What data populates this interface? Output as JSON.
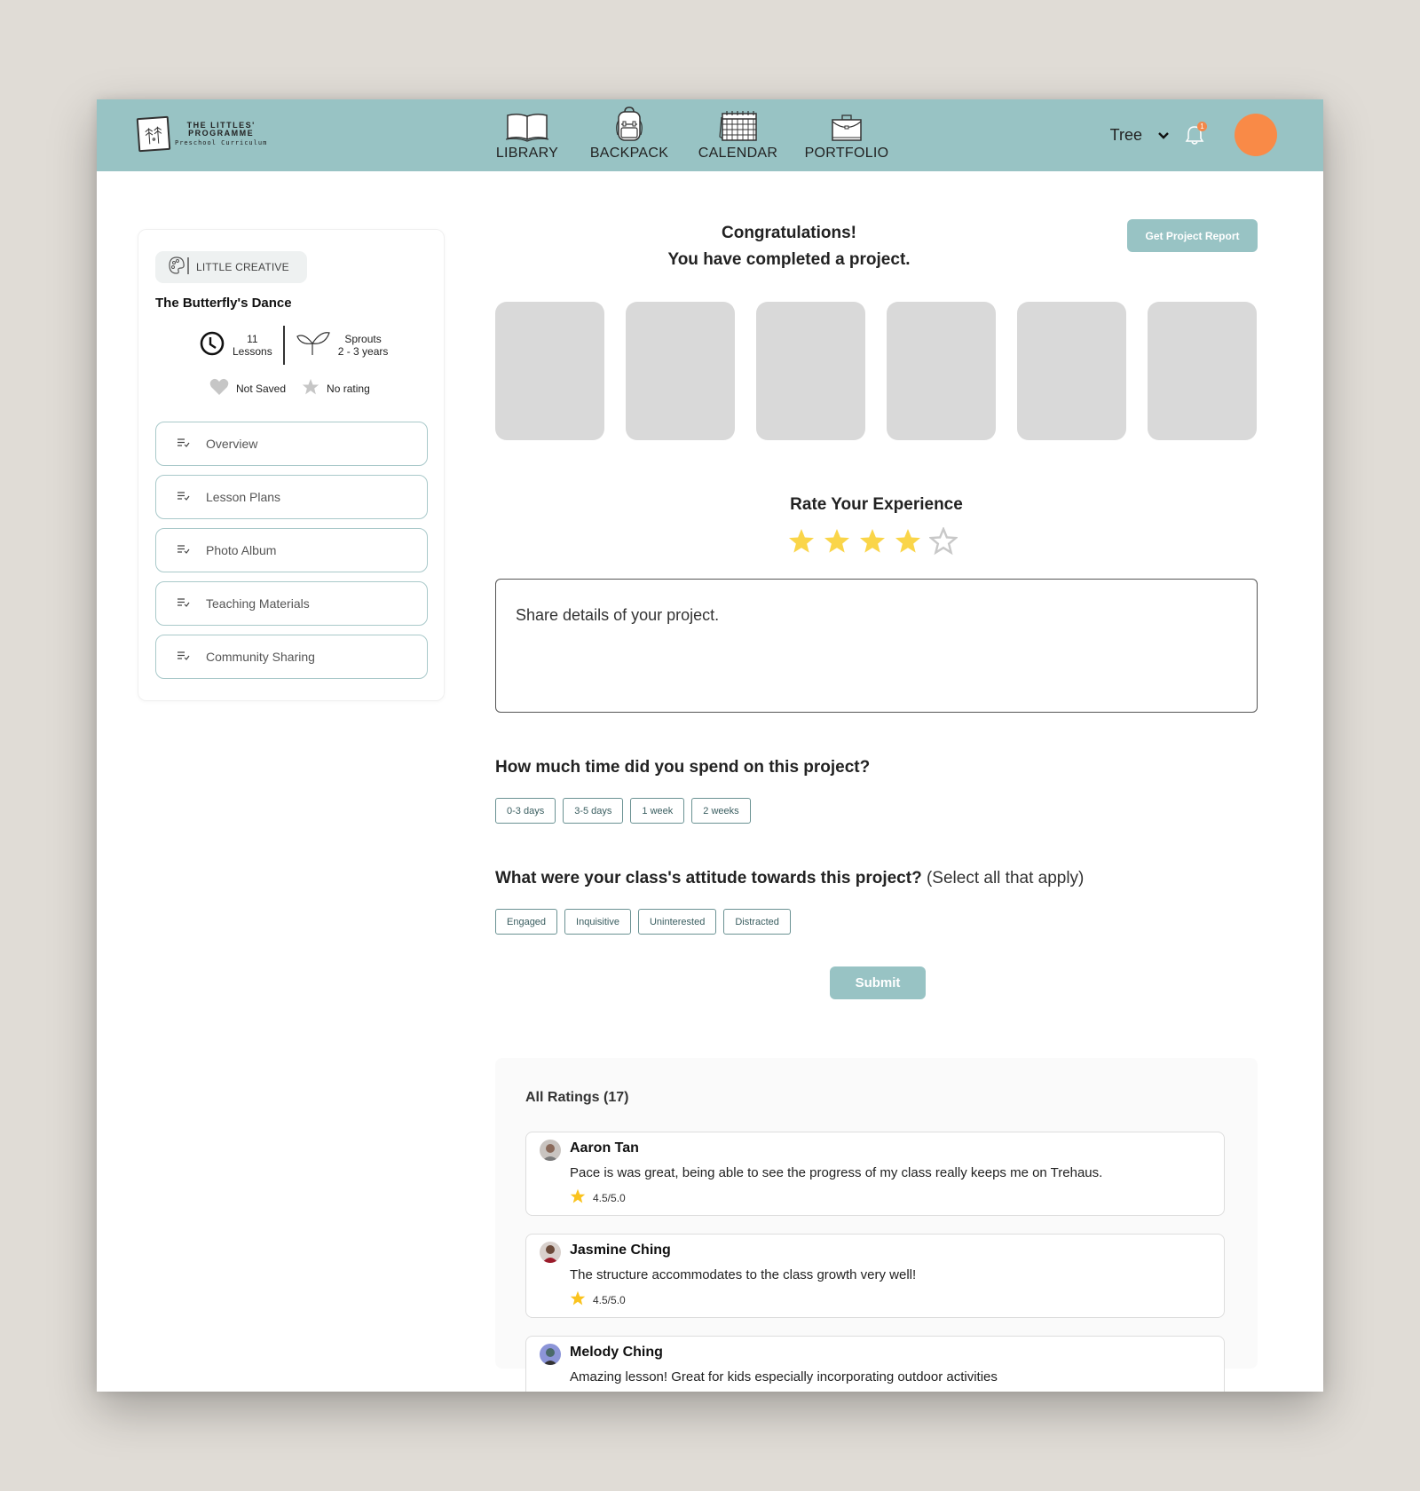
{
  "header": {
    "logo": {
      "line1": "THE LITTLES'",
      "line2": "PROGRAMME",
      "line3": "Preschool Curriculum"
    },
    "nav": [
      {
        "label": "LIBRARY",
        "icon": "book-icon"
      },
      {
        "label": "BACKPACK",
        "icon": "backpack-icon"
      },
      {
        "label": "CALENDAR",
        "icon": "calendar-icon"
      },
      {
        "label": "PORTFOLIO",
        "icon": "briefcase-icon"
      }
    ],
    "user": {
      "name": "Tree",
      "notification_count": "1",
      "avatar_color": "#f98a47"
    }
  },
  "sidebar": {
    "category": "LITTLE CREATIVE",
    "project_title": "The Butterfly's Dance",
    "lessons_count": "11",
    "lessons_label": "Lessons",
    "age_group": "Sprouts",
    "age_range": "2 - 3 years",
    "saved_status": "Not Saved",
    "rating_status": "No rating",
    "menu": [
      {
        "label": "Overview"
      },
      {
        "label": "Lesson Plans"
      },
      {
        "label": "Photo Album"
      },
      {
        "label": "Teaching Materials"
      },
      {
        "label": "Community Sharing"
      }
    ]
  },
  "main": {
    "congrats_line1": "Congratulations!",
    "congrats_line2": "You have completed a project.",
    "report_button": "Get Project Report",
    "photo_count": 6,
    "rate_title": "Rate Your Experience",
    "rating": {
      "value": 4,
      "max": 5,
      "filled_color": "#fad549",
      "empty_color": "#c8c8c8"
    },
    "details_placeholder": "Share details of your project.",
    "time_question": "How much time did you spend on this project?",
    "time_options": [
      "0-3 days",
      "3-5 days",
      "1 week",
      "2 weeks"
    ],
    "attitude_question": "What were your class's attitude towards this project?",
    "attitude_hint": "(Select all that apply)",
    "attitude_options": [
      "Engaged",
      "Inquisitive",
      "Uninterested",
      "Distracted"
    ],
    "submit_button": "Submit"
  },
  "ratings": {
    "title": "All Ratings (17)",
    "reviews": [
      {
        "name": "Aaron Tan",
        "text": "Pace is was great, being able to see the progress of my class really keeps me on Trehaus.",
        "score": "4.5/5.0"
      },
      {
        "name": "Jasmine Ching",
        "text": "The structure accommodates to the class growth very well!",
        "score": "4.5/5.0"
      },
      {
        "name": "Melody Ching",
        "text": "Amazing lesson! Great for kids especially incorporating outdoor activities",
        "score": ""
      }
    ]
  },
  "colors": {
    "accent": "#98c3c4",
    "chip_border": "#6a9293",
    "star": "#fad549"
  }
}
